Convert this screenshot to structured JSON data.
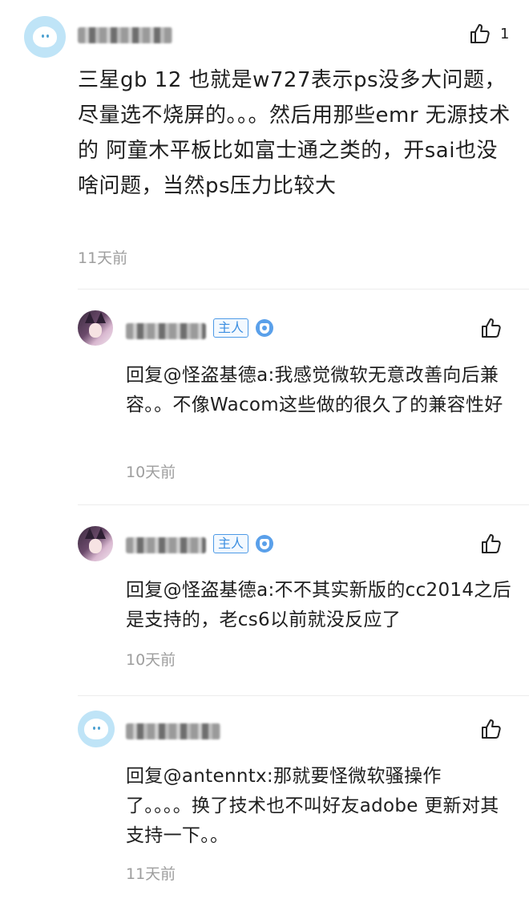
{
  "main_comment": {
    "text": "三星gb 12 也就是w727表示ps没多大问题，尽量选不烧屏的。。。然后用那些emr 无源技术的 阿童木平板比如富士通之类的，开sai也没啥问题，当然ps压力比较大",
    "time": "11天前",
    "like_count": "1",
    "avatar_icon": "blue-bird-avatar"
  },
  "replies": [
    {
      "badge": "主人",
      "text": "回复@怪盗基德a:我感觉微软无意改善向后兼容。。不像Wacom这些做的很久了的兼容性好",
      "time": "10天前",
      "avatar_icon": "anime-girl-avatar"
    },
    {
      "badge": "主人",
      "text": "回复@怪盗基德a:不不其实新版的cc2014之后是支持的，老cs6以前就没反应了",
      "time": "10天前",
      "avatar_icon": "anime-girl-avatar"
    },
    {
      "text": "回复@antenntx:那就要怪微软骚操作了。。。。换了技术也不叫好友adobe 更新对其支持一下。。",
      "time": "11天前",
      "avatar_icon": "blue-bird-avatar"
    }
  ],
  "colors": {
    "text": "#1f1f1f",
    "time": "#9e9e9e",
    "host_badge": "#3d8fe0",
    "avatar_blue": "#bfe4f7"
  }
}
